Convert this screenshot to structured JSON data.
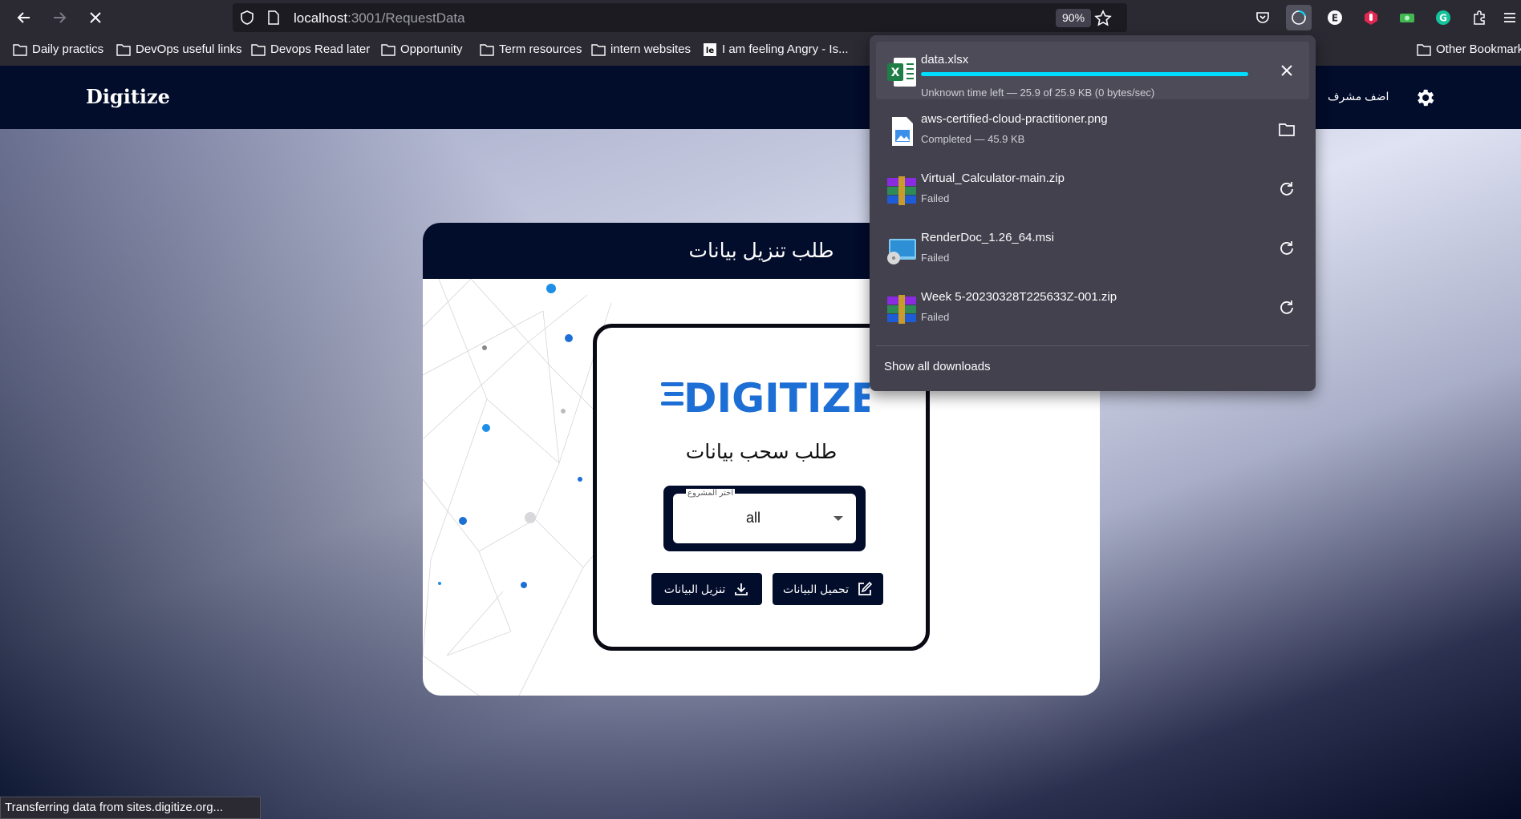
{
  "browser": {
    "url_host": "localhost",
    "url_path": ":3001/RequestData",
    "zoom": "90%"
  },
  "bookmarks": [
    {
      "label": "Daily practics"
    },
    {
      "label": "DevOps useful links"
    },
    {
      "label": "Devops Read later"
    },
    {
      "label": "Opportunity"
    },
    {
      "label": "Term resources"
    },
    {
      "label": "intern websites"
    },
    {
      "label": "I am feeling Angry - Is..."
    },
    {
      "label": "Other Bookmark"
    }
  ],
  "navbar": {
    "brand": "Digitize",
    "link": "اضف مشرف"
  },
  "card": {
    "title": "طلب تنزيل بيانات",
    "logo_text": "DIGITIZE",
    "subtitle": "طلب سحب بيانات",
    "select_label": "اختر المشروع",
    "select_value": "all",
    "upload_button": "تحميل البيانات",
    "download_button": "تنزيل البيانات"
  },
  "downloads": {
    "items": [
      {
        "name": "data.xlsx",
        "status": "Unknown time left — 25.9 of 25.9 KB (0 bytes/sec)",
        "progress": 1.0,
        "action": "close-icon"
      },
      {
        "name": "aws-certified-cloud-practitioner.png",
        "status": "Completed — 45.9 KB",
        "action": "folder-icon"
      },
      {
        "name": "Virtual_Calculator-main.zip",
        "status": "Failed",
        "action": "retry-icon"
      },
      {
        "name": "RenderDoc_1.26_64.msi",
        "status": "Failed",
        "action": "retry-icon"
      },
      {
        "name": "Week 5-20230328T225633Z-001.zip",
        "status": "Failed",
        "action": "retry-icon"
      }
    ],
    "show_all": "Show all downloads"
  },
  "status_bar": "Transferring data from sites.digitize.org...",
  "colors": {
    "navy": "#020c2b",
    "progress": "#00ddff",
    "logo_blue": "#1d6fd6"
  }
}
